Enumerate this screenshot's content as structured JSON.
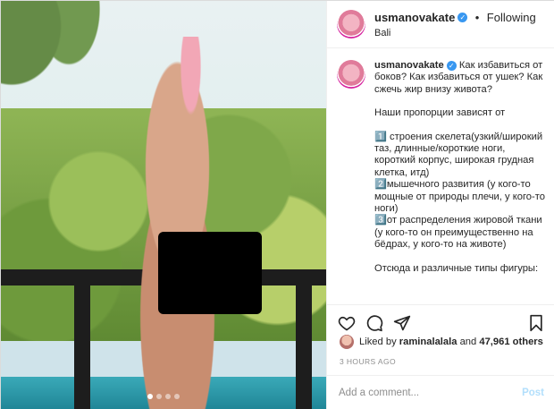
{
  "post": {
    "username": "usmanovakate",
    "separator": "•",
    "follow_status": "Following",
    "location": "Bali",
    "caption": {
      "username": "usmanovakate",
      "intro": "Как избавиться от боков? Как избавиться от ушек? Как сжечь жир внизу живота?",
      "lead": "Наши пропорции зависят от",
      "item1": "1️⃣ строения скелета(узкий/широкий таз, длинные/короткие ноги, короткий корпус, широкая грудная клетка, итд)",
      "item2": "2️⃣мышечного развития (у кого-то мощные от природы плечи, у кого-то ноги)",
      "item3": "3️⃣от распределения жировой ткани (у кого-то он преимущественно на бёдрах, у кого-то на животе)",
      "outro": "Отсюда и различные типы фигуры:"
    },
    "likes": {
      "prefix": "Liked by",
      "user": "raminalalala",
      "and": "and",
      "others": "47,961 others"
    },
    "timestamp": "3 HOURS AGO",
    "comment_placeholder": "Add a comment...",
    "post_label": "Post"
  },
  "carousel": {
    "count": 4,
    "active_index": 0
  },
  "colors": {
    "accent_blue": "#3897f0",
    "post_button": "#b2dffc",
    "text": "#262626",
    "muted": "#8e8e8e"
  },
  "icons": [
    "verified-icon",
    "heart-icon",
    "comment-icon",
    "share-icon",
    "bookmark-icon"
  ]
}
